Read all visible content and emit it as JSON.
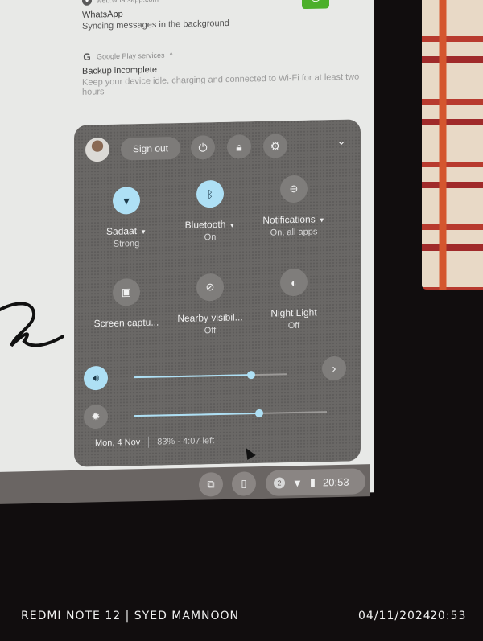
{
  "notifications": [
    {
      "source": "web.whatsapp.com",
      "source_icon": "chrome-icon",
      "title": "WhatsApp",
      "body": "Syncing messages in the background",
      "app_icon": "whatsapp-icon"
    },
    {
      "source": "Google Play services",
      "source_icon": "google-icon",
      "expand_glyph": "^",
      "title": "Backup incomplete",
      "body": "Keep your device idle, charging and connected to Wi-Fi for at least two hours"
    }
  ],
  "quick_settings": {
    "header": {
      "sign_out_label": "Sign out",
      "power_icon": "power-icon",
      "lock_icon": "lock-icon",
      "settings_icon": "gear-icon",
      "collapse_icon": "chevron-down-icon"
    },
    "tiles": [
      {
        "label": "Sadaat",
        "sub": "Strong",
        "icon": "wifi-icon",
        "on": true,
        "has_menu": true
      },
      {
        "label": "Bluetooth",
        "sub": "On",
        "icon": "bluetooth-icon",
        "on": true,
        "has_menu": true
      },
      {
        "label": "Notifications",
        "sub": "On, all apps",
        "icon": "do-not-disturb-icon",
        "on": false,
        "has_menu": true
      },
      {
        "label": "Screen captu...",
        "sub": "",
        "icon": "screen-capture-icon",
        "on": false,
        "has_menu": false
      },
      {
        "label": "Nearby visibil...",
        "sub": "Off",
        "icon": "nearby-visibility-icon",
        "on": false,
        "has_menu": false
      },
      {
        "label": "Night Light",
        "sub": "Off",
        "icon": "night-light-icon",
        "on": false,
        "has_menu": false
      }
    ],
    "volume": {
      "icon": "volume-icon",
      "level_percent": 77
    },
    "brightness": {
      "icon": "brightness-icon",
      "level_percent": 65
    },
    "footer": {
      "date": "Mon, 4 Nov",
      "battery": "83% - 4:07 left"
    }
  },
  "shelf": {
    "tray_time": "20:53",
    "dnd_glyph": "2",
    "icons": [
      "screen-capture-icon",
      "phone-hub-icon",
      "notification-count-icon",
      "wifi-icon",
      "battery-icon"
    ]
  },
  "watermark": {
    "left": "REDMI NOTE 12 | SYED MAMNOON",
    "date": "04/11/2024",
    "time": "20:53"
  },
  "colors": {
    "accent": "#aee0f5",
    "panel": "#6a6866",
    "whatsapp": "#4caf2a"
  }
}
